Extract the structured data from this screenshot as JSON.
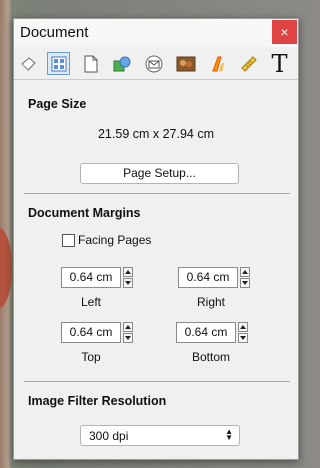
{
  "window": {
    "title": "Document",
    "close_glyph": "×"
  },
  "toolbar": {
    "icons": [
      "general-icon",
      "document-grid-icon",
      "page-icon",
      "shapes-icon",
      "envelope-icon",
      "image-icon",
      "text-style-icon",
      "ruler-icon",
      "text-tool-icon"
    ],
    "active_index": 1,
    "text_tool_glyph": "T"
  },
  "page_size": {
    "title": "Page Size",
    "value": "21.59 cm x 27.94 cm",
    "setup_button": "Page Setup..."
  },
  "margins": {
    "title": "Document Margins",
    "facing_pages_label": "Facing Pages",
    "facing_pages_checked": false,
    "left": {
      "value": "0.64 cm",
      "label": "Left"
    },
    "right": {
      "value": "0.64 cm",
      "label": "Right"
    },
    "top": {
      "value": "0.64 cm",
      "label": "Top"
    },
    "bottom": {
      "value": "0.64 cm",
      "label": "Bottom"
    }
  },
  "image_filter": {
    "title": "Image Filter Resolution",
    "selected": "300 dpi"
  },
  "colors": {
    "close": "#e04343",
    "active_tool_border": "#6c9bd2"
  }
}
